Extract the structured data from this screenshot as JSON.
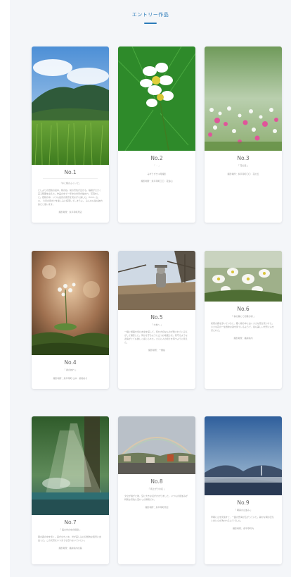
{
  "header": {
    "title": "エントリー作品"
  },
  "cards": [
    {
      "no": "No.1",
      "sub": "「水と緑のふくいで」",
      "desc": "たしよりの田植の最中、緑の谷、前の景色が広がる。稲穂が大きく実る時期を迎えた。作品の中で一年中の光景が描かれ、写真をした。若緑の中、いつも最高の風景を見ながら楽しむ。Hmm, 山、川、 今日の見かけを楽しみに探索してしまうよ。 みんなも最も魅力的だと思います。",
      "meta": "撮影場所：永平寺町周辺"
    },
    {
      "no": "No.2",
      "sub": "「 ...  」",
      "sub2": "みずうずき 6月撮影",
      "meta": "撮影場所：永平寺町〇〇　花浴山"
    },
    {
      "no": "No.3",
      "sub": "「 花の道 」",
      "meta": "撮影場所：永平寺町〇〇　花の丘"
    },
    {
      "no": "No.4",
      "sub": "「 春の訪れ 」",
      "meta": "撮影場所：永平寺町 山中　植物あり"
    },
    {
      "no": "No.5",
      "sub": "「 大地へ 」",
      "desc": "一緒に旅路を歩む友達を探して、何か大切なものが残されている気がして撮影した。何かを守るように立つお地蔵さま。見守るような表情がとても優しく感じられた。さらに人の帰りを待つように見えた。",
      "meta": "撮影場所：一乗谷"
    },
    {
      "no": "No.6",
      "sub": "「 春の森にて初夏の頃 」",
      "desc": "初夏の森を歩いていると、輝く緑の中に白く小さな花を見つけた。小さな花の一生懸命な姿を見ているようで、最も美しい光景に心を打たれた。",
      "meta": "撮影場所：福井県内"
    },
    {
      "no": "No.7",
      "sub": "「 森の光の中の時間 」",
      "desc": "朝の森の中を歩く。霧が立ちこめ、光が差し込む幻想的な風景に出会った。この光景をいつまでも忘れないでいたい。",
      "meta": "撮影場所：福井県内の森"
    },
    {
      "no": "No.8",
      "sub": "「 雨上がりの虹 」",
      "desc": "夕立が過ぎた後、空に大きな虹がかかりました。いつもの街並みが特別な景色に変わった瞬間です。",
      "meta": "撮影場所：永平寺町周辺"
    },
    {
      "no": "No.9",
      "sub": "「 朝霧の山並み 」",
      "desc": "早朝に山を見渡すと、一面の雲海が広がっていた。静かな朝の空気と共に心が洗われるようでした。",
      "meta": "撮影場所：永平寺町内"
    }
  ],
  "colors": {
    "accent": "#2b7bb9",
    "background": "#f4f6f9"
  }
}
